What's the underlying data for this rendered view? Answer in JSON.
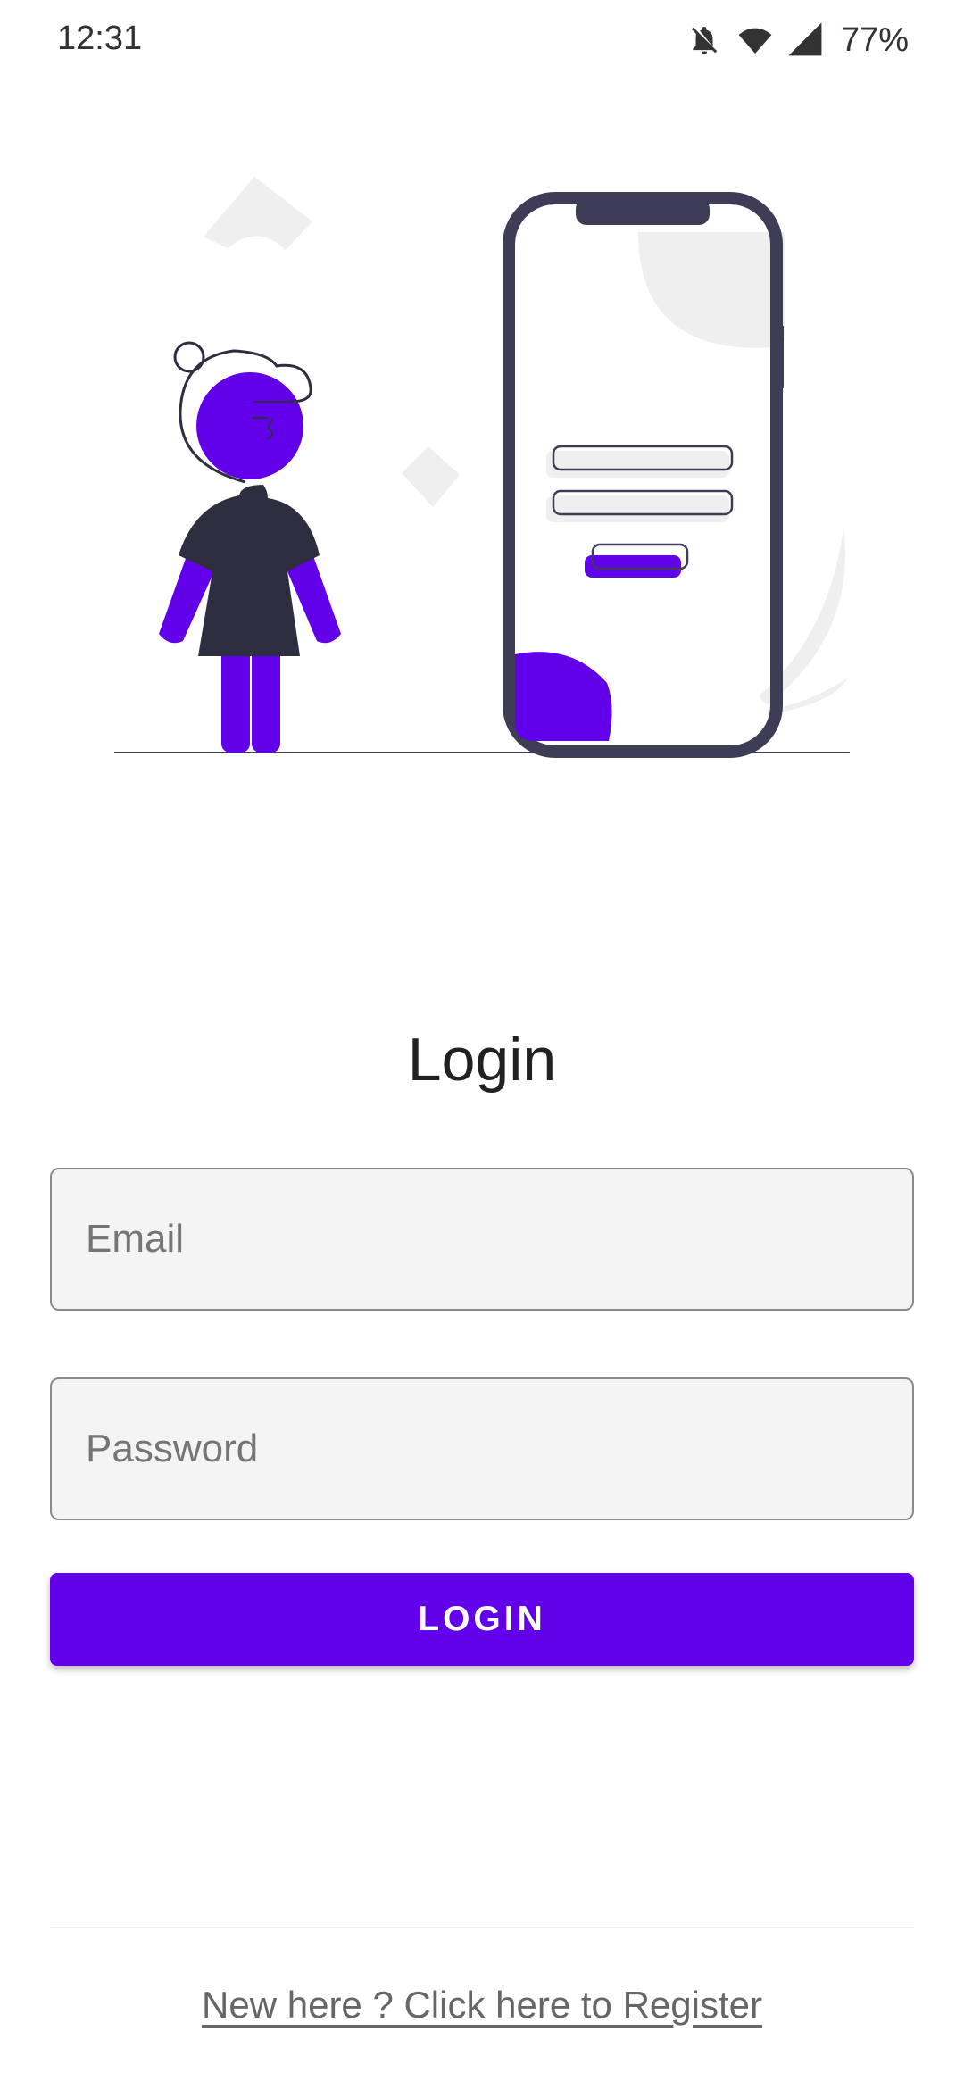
{
  "status_bar": {
    "time": "12:31",
    "battery": "77%",
    "icons": [
      "notifications-off-icon",
      "wifi-icon",
      "signal-icon"
    ]
  },
  "illustration": {
    "accent_color": "#6200ea",
    "dark_color": "#3f3d56"
  },
  "login": {
    "title": "Login",
    "email_placeholder": "Email",
    "password_placeholder": "Password",
    "button_label": "LOGIN",
    "register_link": "New here ? Click here to Register"
  },
  "colors": {
    "primary": "#6200ea",
    "field_background": "#f4f4f4",
    "field_border": "#8a8a8a"
  }
}
